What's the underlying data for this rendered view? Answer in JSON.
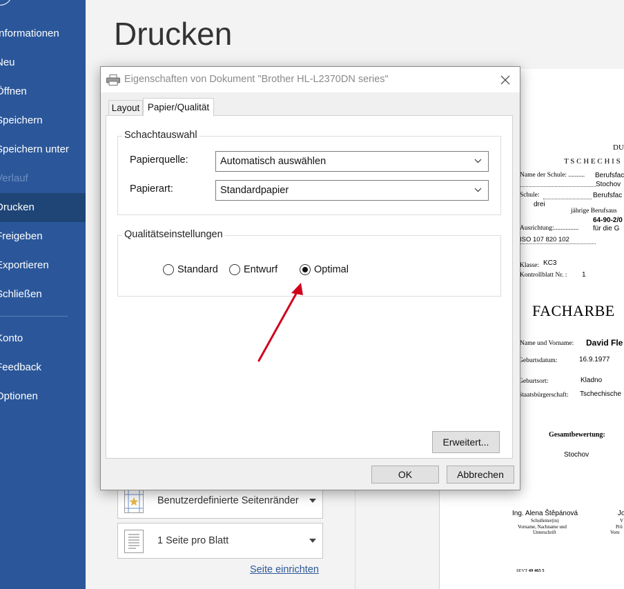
{
  "sidebar": {
    "items": [
      {
        "label": "Informationen"
      },
      {
        "label": "Neu"
      },
      {
        "label": "Öffnen"
      },
      {
        "label": "Speichern"
      },
      {
        "label": "Speichern unter"
      },
      {
        "label": "Verlauf"
      },
      {
        "label": "Drucken"
      },
      {
        "label": "Freigeben"
      },
      {
        "label": "Exportieren"
      },
      {
        "label": "Schließen"
      },
      {
        "label": "Konto"
      },
      {
        "label": "Feedback"
      },
      {
        "label": "Optionen"
      }
    ],
    "active": "Drucken",
    "disabled": "Verlauf",
    "back_icon": "back-arrow-icon"
  },
  "main": {
    "title": "Drucken",
    "settings": [
      {
        "label": "Benutzerdefinierte Seitenränder",
        "icon": "margins-icon"
      },
      {
        "label": "1 Seite pro Blatt",
        "icon": "pages-per-sheet-icon"
      }
    ],
    "page_setup_link": "Seite einrichten"
  },
  "dialog": {
    "title": "Eigenschaften von Dokument \"Brother HL-L2370DN series\"",
    "tabs": [
      {
        "label": "Layout",
        "selected": false
      },
      {
        "label": "Papier/Qualität",
        "selected": true
      }
    ],
    "tray_group": {
      "title": "Schachtauswahl",
      "paper_source_label": "Papierquelle:",
      "paper_source_value": "Automatisch auswählen",
      "paper_type_label": "Papierart:",
      "paper_type_value": "Standardpapier"
    },
    "quality_group": {
      "title": "Qualitätseinstellungen",
      "options": [
        {
          "label": "Standard",
          "checked": false
        },
        {
          "label": "Entwurf",
          "checked": false
        },
        {
          "label": "Optimal",
          "checked": true
        }
      ]
    },
    "advanced_button": "Erweitert...",
    "ok_button": "OK",
    "cancel_button": "Abbrechen"
  },
  "preview": {
    "du": "DU",
    "tschechis": "T S C H E C H I S",
    "school_name_label": "Name der Schule: ..........",
    "school_name_value": "Berufsfac",
    "school_name_value2": "Stochov",
    "school_label": "Schule:",
    "school_value": "Berufsfac",
    "drei": "drei",
    "jaehrige": "jährige Berufsaus",
    "code": "64-90-2/0",
    "ausrichtung_label": "Ausrichtung:...............",
    "ausrichtung_value": "für die G",
    "iso": "ISO   107 820 102",
    "klasse_label": "Klasse:",
    "klasse_value": "KC3",
    "kontrollblatt_label": "Kontrollblatt Nr. :",
    "kontrollblatt_value": "1",
    "heading": "FACHARBE",
    "name_label": "Name und Vorname:",
    "name_value": "David Fle",
    "birth_label": "Geburtsdatum:",
    "birth_value": "16.9.1977",
    "birthplace_label": "Geburtsort:",
    "birthplace_value": "Kladno",
    "citizenship_label": "Staatsbürgerschaft:",
    "citizenship_value": "Tschechische",
    "gesamt": "Gesamtbewertung:",
    "place": "Stochov",
    "signer": "Ing. Alena Štěpánová",
    "signer_role1": "Schulleiter(in)",
    "signer_role2": "Vorname, Nachname und",
    "signer_role3": "Unterschrift",
    "signer2": "Jo",
    "signer2_l1": "V",
    "signer2_l2": "Prü",
    "signer2_l3": "Vorn",
    "sevt_prefix": "SEVT",
    "sevt_number": "49 465 5"
  },
  "annotation": {
    "color": "#d0021b"
  }
}
